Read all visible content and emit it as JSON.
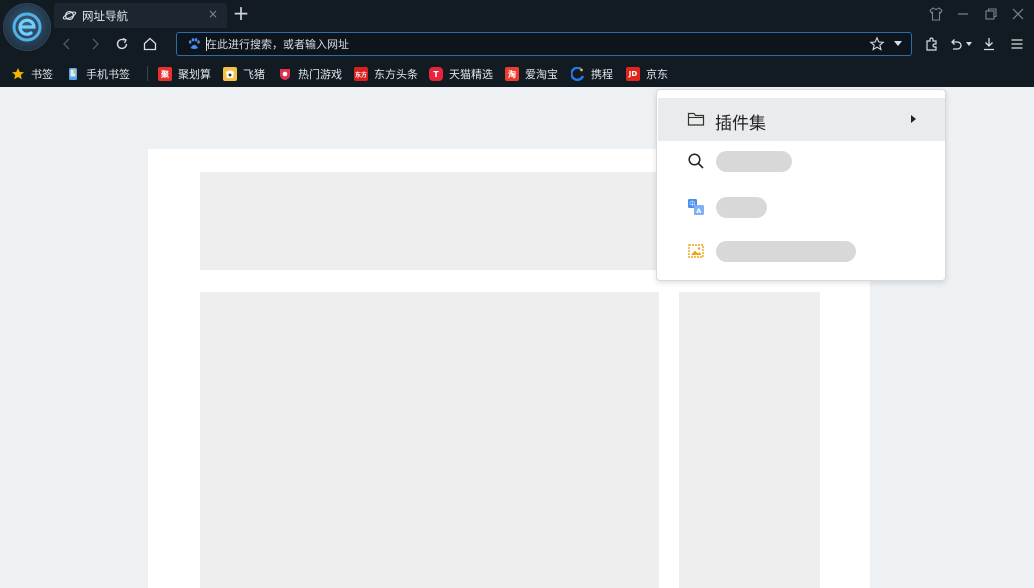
{
  "tab": {
    "title": "网址导航",
    "close": "×"
  },
  "new_tab": "+",
  "address_bar": {
    "placeholder": "在此进行搜索，或者输入网址",
    "value": ""
  },
  "bookmarks": [
    {
      "label": "书签",
      "icon": "star-icon",
      "color": "#f5b400",
      "glyph": ""
    },
    {
      "label": "手机书签",
      "icon": "phone-bookmark-icon",
      "color": "#5aa4ef",
      "glyph": ""
    },
    {
      "label": "聚划算",
      "icon": "juhuasuan-icon",
      "color": "#e8312f",
      "glyph": "聚"
    },
    {
      "label": "飞猪",
      "icon": "feizhu-icon",
      "color": "#f6c244",
      "glyph": ""
    },
    {
      "label": "热门游戏",
      "icon": "game-icon",
      "color": "#e0314d",
      "glyph": ""
    },
    {
      "label": "东方头条",
      "icon": "dftt-icon",
      "color": "#d8201d",
      "glyph": "东方"
    },
    {
      "label": "天猫精选",
      "icon": "tmall-icon",
      "color": "#e8233b",
      "glyph": "T"
    },
    {
      "label": "爱淘宝",
      "icon": "aitaobao-icon",
      "color": "#ec3d2f",
      "glyph": "淘"
    },
    {
      "label": "携程",
      "icon": "ctrip-icon",
      "color": "#2c77e6",
      "glyph": ""
    },
    {
      "label": "京东",
      "icon": "jd-icon",
      "color": "#e1251b",
      "glyph": "JD"
    }
  ],
  "menu": {
    "plugins_label": "插件集",
    "items": [
      {
        "icon": "search-icon"
      },
      {
        "icon": "translate-icon"
      },
      {
        "icon": "image-icon"
      }
    ]
  },
  "colors": {
    "chrome_bg": "#121a22",
    "accent": "#2b6ea8",
    "page_bg": "#eef1f4",
    "placeholder": "#eeeeee",
    "menu_hover": "#e9ebed"
  }
}
